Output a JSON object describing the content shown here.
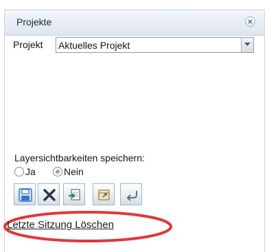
{
  "panel": {
    "title": "Projekte"
  },
  "project": {
    "label": "Projekt",
    "selected_value": "Aktuelles Projekt"
  },
  "layer_visibility": {
    "label": "Layersichtbarkeiten speichern:",
    "options": [
      {
        "label": "Ja",
        "selected": false
      },
      {
        "label": "Nein",
        "selected": true
      }
    ]
  },
  "toolbar": {
    "buttons": [
      {
        "icon": "save-icon"
      },
      {
        "icon": "delete-icon"
      },
      {
        "icon": "import-icon"
      },
      {
        "icon": "export-icon"
      },
      {
        "icon": "undo-icon"
      }
    ]
  },
  "links": {
    "delete_session": "Letzte Sitzung Löschen"
  },
  "colors": {
    "header_bg": "#dde6f0",
    "highlight_ellipse": "#e0383c",
    "delete_icon": "#2a3440",
    "save_icon": "#3a74c8"
  }
}
